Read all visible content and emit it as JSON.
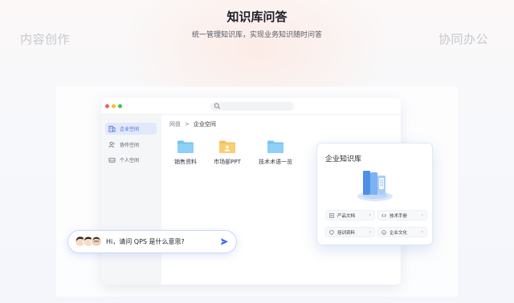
{
  "header": {
    "title": "知识库问答",
    "subtitle": "统一管理知识库，实现业务知识随时问答",
    "left_word": "内容创作",
    "right_word": "协同办公"
  },
  "window": {
    "sidebar": [
      {
        "label": "企业空间",
        "icon": "building-icon",
        "active": true
      },
      {
        "label": "协作空间",
        "icon": "people-icon",
        "active": false
      },
      {
        "label": "个人空间",
        "icon": "drive-icon",
        "active": false
      }
    ],
    "breadcrumb": {
      "root": "网盘",
      "separator": ">",
      "current": "企业空间"
    },
    "folders": [
      {
        "label": "销售资料",
        "color": "#76c3f2"
      },
      {
        "label": "市场部PPT",
        "color": "#f5c15e"
      },
      {
        "label": "技术术语一览",
        "color": "#76c3f2"
      }
    ]
  },
  "knowledge_card": {
    "title": "企业知识库",
    "items": [
      {
        "label": "产品文档",
        "icon": "document-icon"
      },
      {
        "label": "技术手册",
        "icon": "code-icon"
      },
      {
        "label": "培训资料",
        "icon": "shield-icon"
      },
      {
        "label": "企业文化",
        "icon": "smile-icon"
      }
    ],
    "chevron": "›"
  },
  "chat": {
    "message": "Hi，请问 QPS 是什么意思?"
  },
  "colors": {
    "accent": "#3b6de3",
    "folder_blue": "#76c3f2",
    "folder_yellow": "#f5c15e"
  }
}
